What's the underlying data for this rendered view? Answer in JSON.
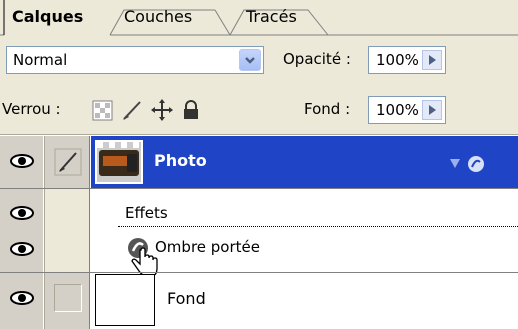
{
  "tabs": [
    {
      "label": "Calques",
      "active": true
    },
    {
      "label": "Couches",
      "active": false
    },
    {
      "label": "Tracés",
      "active": false
    }
  ],
  "blend": {
    "mode": "Normal",
    "opacity_label": "Opacité :",
    "opacity_value": "100%"
  },
  "lock": {
    "label": "Verrou :",
    "fill_label": "Fond :",
    "fill_value": "100%"
  },
  "layers": [
    {
      "name": "Photo",
      "selected": true
    },
    {
      "name": "Effets"
    },
    {
      "name": "Ombre portée"
    },
    {
      "name": "Fond"
    }
  ],
  "colors": {
    "selection": "#1F45C6",
    "panel": "#ECE9D8"
  },
  "icons": [
    "eye-icon",
    "brush-icon",
    "transparency-lock-icon",
    "paint-lock-icon",
    "move-lock-icon",
    "padlock-icon",
    "fx-icon",
    "hand-cursor-icon"
  ]
}
